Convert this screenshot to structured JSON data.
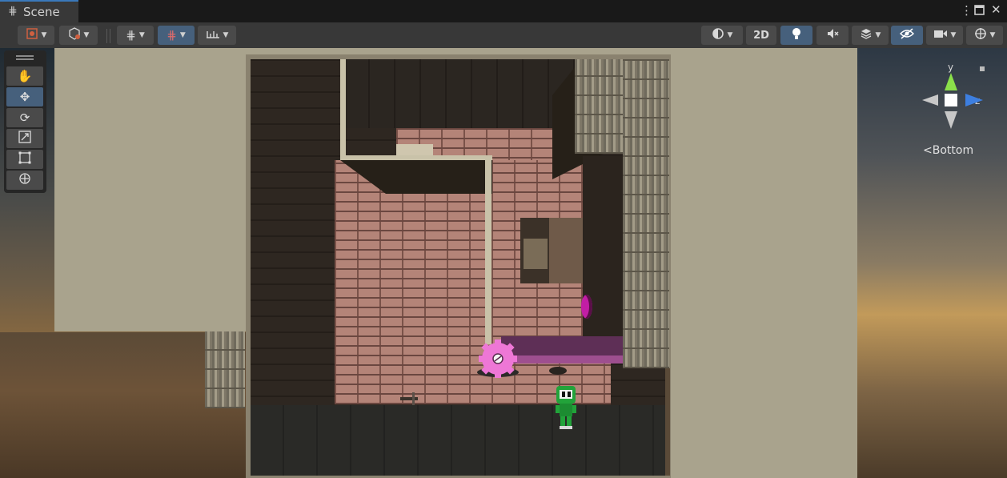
{
  "window": {
    "tab_title": "Scene",
    "tab_icon": "grid-icon",
    "controls": [
      "menu-icon",
      "maximize-icon",
      "close-icon"
    ]
  },
  "toolbar": {
    "left_tools": [
      {
        "name": "gizmo-pivot-icon",
        "dropdown": true
      },
      {
        "name": "global-local-icon",
        "dropdown": true
      },
      {
        "name": "grid-snap-icon",
        "dropdown": true
      },
      {
        "name": "snap-increment-icon",
        "dropdown": true,
        "active": true
      },
      {
        "name": "ruler-icon",
        "dropdown": true
      }
    ],
    "right_tools": [
      {
        "name": "draw-mode-icon",
        "dropdown": true
      },
      {
        "name": "2d-toggle",
        "label": "2D"
      },
      {
        "name": "lighting-toggle-icon",
        "active": true
      },
      {
        "name": "audio-toggle-icon"
      },
      {
        "name": "effects-icon",
        "dropdown": true
      },
      {
        "name": "scene-visibility-icon",
        "active": true
      },
      {
        "name": "camera-icon",
        "dropdown": true
      },
      {
        "name": "gizmos-icon",
        "dropdown": true
      }
    ],
    "label_2d": "2D"
  },
  "tool_palette": {
    "items": [
      "hand-icon",
      "move-icon",
      "rotate-icon",
      "scale-icon",
      "rect-icon",
      "transform-icon"
    ],
    "active_index": 1
  },
  "gizmo": {
    "y_label": "y",
    "z_label": "z",
    "view_label": "<Bottom"
  },
  "colors": {
    "accent": "#3a79bb",
    "active_button": "#46607c",
    "panel": "#383838",
    "brick": "#b48478",
    "pink_gear": "#ee77d6",
    "purple_platform": "#7a3d6f",
    "player_green": "#22a33a"
  }
}
